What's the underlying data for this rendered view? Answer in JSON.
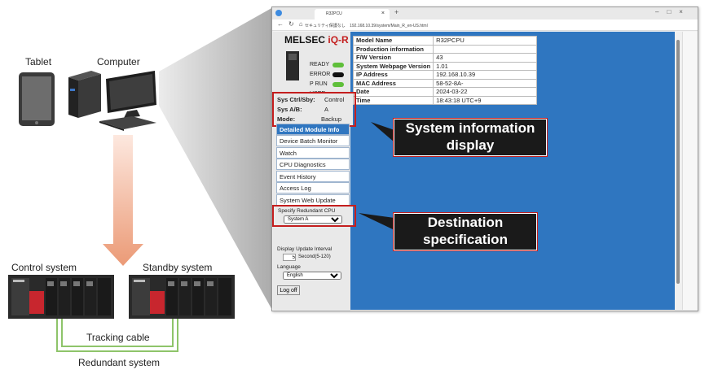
{
  "labels": {
    "tablet": "Tablet",
    "computer": "Computer",
    "control_system": "Control system",
    "standby_system": "Standby system",
    "tracking_cable": "Tracking cable",
    "redundant_system": "Redundant system"
  },
  "callouts": {
    "system_info_line1": "System information",
    "system_info_line2": "display",
    "destination_line1": "Destination",
    "destination_line2": "specification"
  },
  "browser": {
    "tab_title": "R32PCU",
    "url": "192.168.10.39/system/Main_R_en-US.html",
    "url_prefix": "セキュリティ保護なし"
  },
  "brand": {
    "name": "MELSEC",
    "series": "iQ-R"
  },
  "leds": [
    {
      "label": "READY",
      "color": "#5fbf3a"
    },
    {
      "label": "ERROR",
      "color": "#111111"
    },
    {
      "label": "P RUN",
      "color": "#5fbf3a"
    },
    {
      "label": "USER",
      "color": "#111111"
    }
  ],
  "sysinfo": {
    "ctrl_label": "Sys Ctrl/Sby:",
    "ctrl_value": "Control",
    "ab_label": "Sys A/B:",
    "ab_value": "A",
    "mode_label": "Mode:",
    "mode_value": "Backup"
  },
  "menu": {
    "header": "Detailed Module Info",
    "items": [
      "Device Batch Monitor",
      "Watch",
      "CPU Diagnostics",
      "Event History",
      "Access Log",
      "System Web Update"
    ]
  },
  "redundant": {
    "label": "Specify Redundant CPU",
    "value": "System A"
  },
  "settings": {
    "interval_label": "Display Update Interval",
    "interval_value": "5",
    "interval_unit": "Second(5-120)",
    "language_label": "Language",
    "language_value": "English",
    "logoff": "Log off"
  },
  "table": [
    {
      "key": "Model Name",
      "value": "R32PCPU"
    },
    {
      "key": "Production information",
      "value": ""
    },
    {
      "key": "F/W Version",
      "value": "43"
    },
    {
      "key": "System Webpage Version",
      "value": "1.01"
    },
    {
      "key": "IP Address",
      "value": "192.168.10.39"
    },
    {
      "key": "MAC Address",
      "value": "58-52-8A-"
    },
    {
      "key": "Date",
      "value": "2024-03-22"
    },
    {
      "key": "Time",
      "value": "18:43:18 UTC+9"
    }
  ],
  "colors": {
    "accent": "#c41e1e",
    "panel_blue": "#2f76c0",
    "arrow": "#eb9a76",
    "cable": "#8ec46a"
  }
}
